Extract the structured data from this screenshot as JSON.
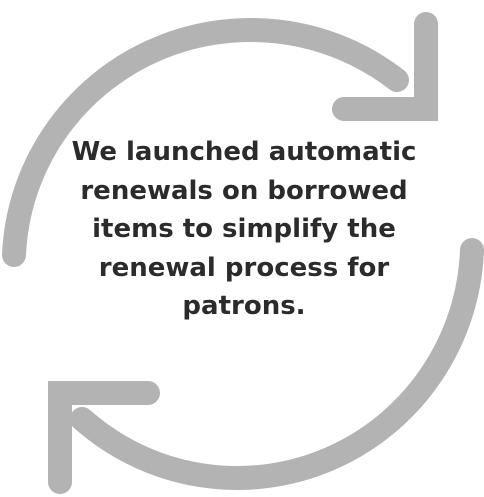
{
  "diagram": {
    "message": "We launched automatic renewals on borrowed items to simplify the renewal process for patrons.",
    "arrow_color": "#b3b3b3",
    "text_color": "#2b2b2b",
    "background": "#ffffff",
    "arrows": [
      {
        "name": "top-arrow",
        "direction": "clockwise"
      },
      {
        "name": "bottom-arrow",
        "direction": "clockwise"
      }
    ]
  }
}
